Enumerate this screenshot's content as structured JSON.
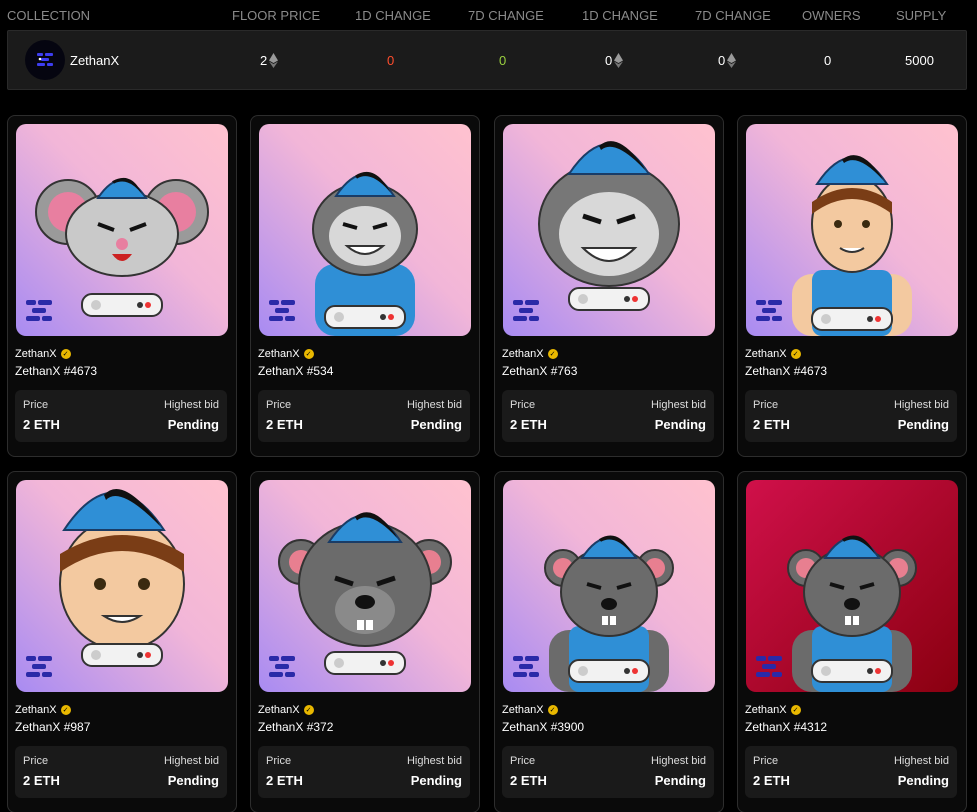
{
  "stats": {
    "columns": [
      "COLLECTION",
      "FLOOR PRICE",
      "1D CHANGE",
      "7D CHANGE",
      "1D CHANGE",
      "7D CHANGE",
      "OWNERS",
      "SUPPLY"
    ],
    "row": {
      "name": "ZethanX",
      "floor_price": "2",
      "change_1d_pct": "0",
      "change_7d_pct": "0",
      "change_1d_eth": "0",
      "change_7d_eth": "0",
      "owners": "0",
      "supply": "5000"
    }
  },
  "cards": [
    {
      "collection": "ZethanX",
      "name": "ZethanX #4673",
      "price_label": "Price",
      "price": "2 ETH",
      "bid_label": "Highest bid",
      "bid": "Pending",
      "character": "mouse-gray",
      "bg": "purple-pink"
    },
    {
      "collection": "ZethanX",
      "name": "ZethanX #534",
      "price_label": "Price",
      "price": "2 ETH",
      "bid_label": "Highest bid",
      "bid": "Pending",
      "character": "gorilla-tank",
      "bg": "purple-pink"
    },
    {
      "collection": "ZethanX",
      "name": "ZethanX #763",
      "price_label": "Price",
      "price": "2 ETH",
      "bid_label": "Highest bid",
      "bid": "Pending",
      "character": "gorilla-head",
      "bg": "purple-pink"
    },
    {
      "collection": "ZethanX",
      "name": "ZethanX #4673",
      "price_label": "Price",
      "price": "2 ETH",
      "bid_label": "Highest bid",
      "bid": "Pending",
      "character": "boy-tank",
      "bg": "purple-pink"
    },
    {
      "collection": "ZethanX",
      "name": "ZethanX #987",
      "price_label": "Price",
      "price": "2 ETH",
      "bid_label": "Highest bid",
      "bid": "Pending",
      "character": "boy-head",
      "bg": "purple-pink"
    },
    {
      "collection": "ZethanX",
      "name": "ZethanX #372",
      "price_label": "Price",
      "price": "2 ETH",
      "bid_label": "Highest bid",
      "bid": "Pending",
      "character": "rat-head",
      "bg": "purple-pink"
    },
    {
      "collection": "ZethanX",
      "name": "ZethanX #3900",
      "price_label": "Price",
      "price": "2 ETH",
      "bid_label": "Highest bid",
      "bid": "Pending",
      "character": "rat-tank",
      "bg": "purple-pink"
    },
    {
      "collection": "ZethanX",
      "name": "ZethanX #4312",
      "price_label": "Price",
      "price": "2 ETH",
      "bid_label": "Highest bid",
      "bid": "Pending",
      "character": "rat-tank",
      "bg": "red"
    }
  ],
  "colors": {
    "change_negative": "#ff4d2d",
    "change_positive": "#9bd13f",
    "verified_badge": "#e9b800",
    "cap_blue": "#2f8fd6"
  }
}
